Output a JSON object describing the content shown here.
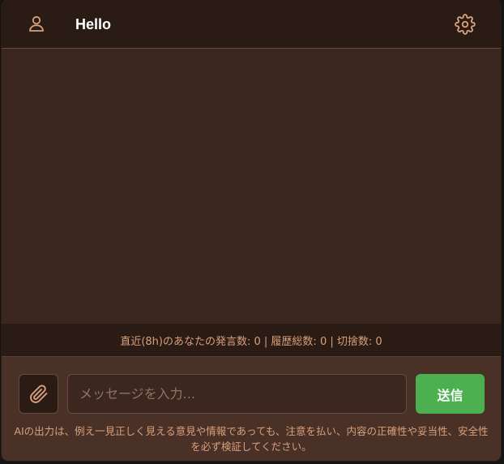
{
  "header": {
    "title": "Hello",
    "user_icon": "user-icon",
    "settings_icon": "gear-icon"
  },
  "stats": {
    "text": "直近(8h)のあなたの発言数: 0 | 履歴総数: 0 | 切捨数: 0"
  },
  "composer": {
    "attach_icon": "paperclip-icon",
    "input_value": "",
    "input_placeholder": "メッセージを入力...",
    "send_label": "送信"
  },
  "disclaimer": "AIの出力は、例え一見正しく見える意見や情報であっても、注意を払い、内容の正確性や妥当性、安全性を必ず検証してください。",
  "colors": {
    "header_bg": "#2a1b15",
    "chat_bg": "#3b2720",
    "input_area_bg": "#4a3127",
    "accent_text": "#d9a07a",
    "send_button": "#4caf50"
  }
}
